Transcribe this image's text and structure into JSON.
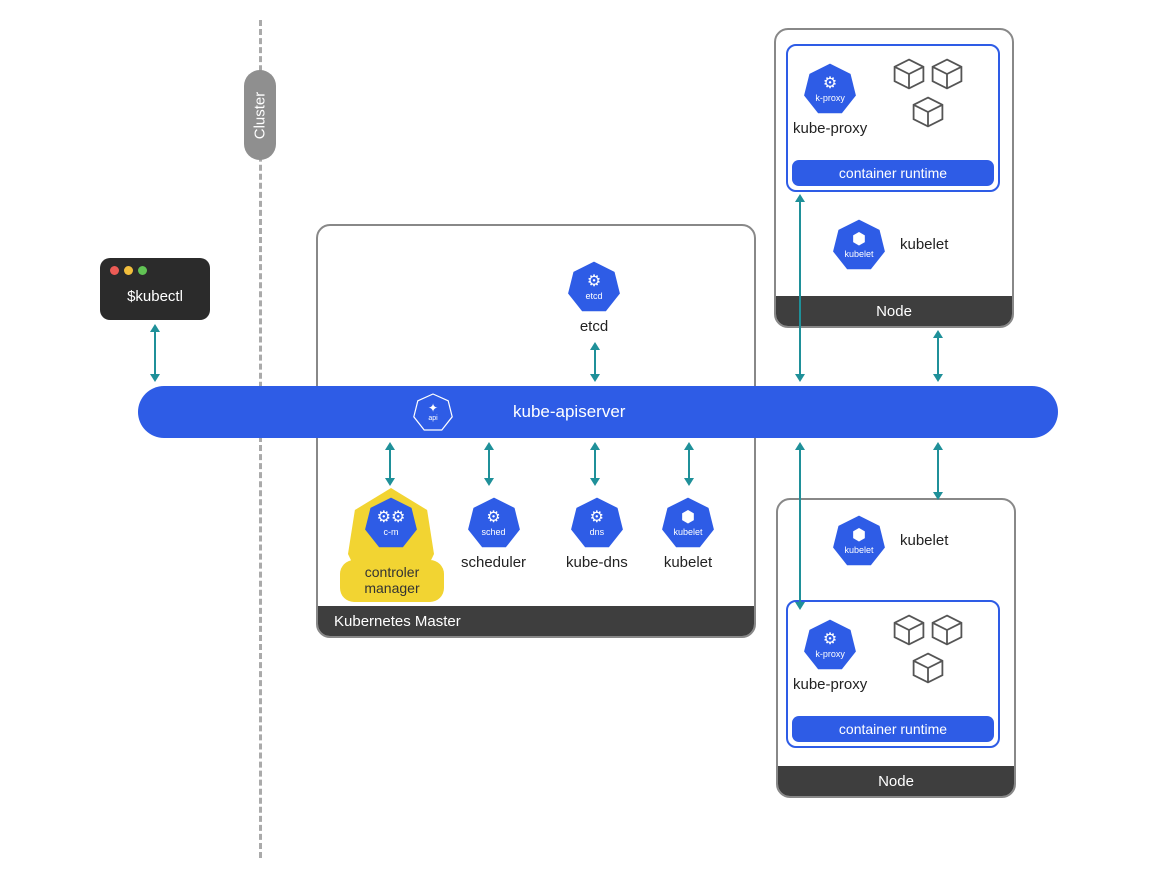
{
  "cluster_label": "Cluster",
  "kubectl": "$kubectl",
  "apiserver": {
    "label": "kube-apiserver",
    "icon_tag": "api"
  },
  "master": {
    "title": "Kubernetes Master",
    "etcd": {
      "label": "etcd",
      "icon_tag": "etcd"
    },
    "controller_manager": {
      "label": "controler\nmanager",
      "icon_tag": "c-m"
    },
    "scheduler": {
      "label": "scheduler",
      "icon_tag": "sched"
    },
    "kube_dns": {
      "label": "kube-dns",
      "icon_tag": "dns"
    },
    "kubelet": {
      "label": "kubelet",
      "icon_tag": "kubelet"
    }
  },
  "node1": {
    "title": "Node",
    "kube_proxy": {
      "label": "kube-proxy",
      "icon_tag": "k-proxy"
    },
    "container_runtime": "container runtime",
    "kubelet": {
      "label": "kubelet",
      "icon_tag": "kubelet"
    }
  },
  "node2": {
    "title": "Node",
    "kube_proxy": {
      "label": "kube-proxy",
      "icon_tag": "k-proxy"
    },
    "container_runtime": "container runtime",
    "kubelet": {
      "label": "kubelet",
      "icon_tag": "kubelet"
    }
  },
  "colors": {
    "kube_blue": "#2e5ce6",
    "highlight_yellow": "#f2d432",
    "arrow_teal": "#1f9099",
    "box_footer": "#3e3e3e"
  }
}
